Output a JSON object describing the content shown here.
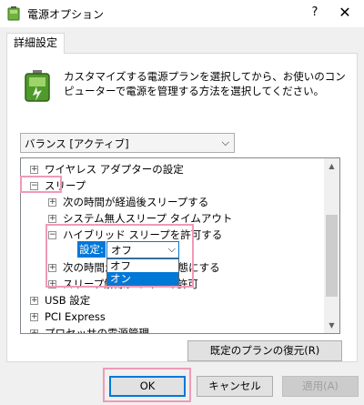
{
  "window": {
    "title": "電源オプション",
    "help_label": "?",
    "close_label": "✕"
  },
  "tab": {
    "label": "詳細設定"
  },
  "description": "カスタマイズする電源プランを選択してから、お使いのコンピューターで電源を管理する方法を選択してください。",
  "plan": {
    "selected": "バランス [アクティブ]"
  },
  "tree": {
    "items": [
      {
        "label": "ワイヤレス アダプターの設定",
        "toggle": "+"
      },
      {
        "label": "スリープ",
        "toggle": "−"
      },
      {
        "label": "次の時間が経過後スリープする",
        "toggle": "+"
      },
      {
        "label": "システム無人スリープ タイムアウト",
        "toggle": "+"
      },
      {
        "label": "ハイブリッド スリープを許可する",
        "toggle": "−"
      },
      {
        "label": "次の時間が経過後休止状態にする",
        "toggle": "+"
      },
      {
        "label": "スリープ解除タイマーの許可",
        "toggle": "+"
      },
      {
        "label": "USB 設定",
        "toggle": "+"
      },
      {
        "label": "PCI Express",
        "toggle": "+"
      },
      {
        "label": "プロセッサの電源管理",
        "toggle": "+"
      }
    ],
    "setting_label": "設定:",
    "setting_value": "オフ",
    "dropdown_options": [
      "オフ",
      "オン"
    ]
  },
  "buttons": {
    "restore": "既定のプランの復元(R)",
    "ok": "OK",
    "cancel": "キャンセル",
    "apply": "適用(A)"
  },
  "colors": {
    "highlight": "#0078d7",
    "annotation": "#ef9ab8"
  }
}
